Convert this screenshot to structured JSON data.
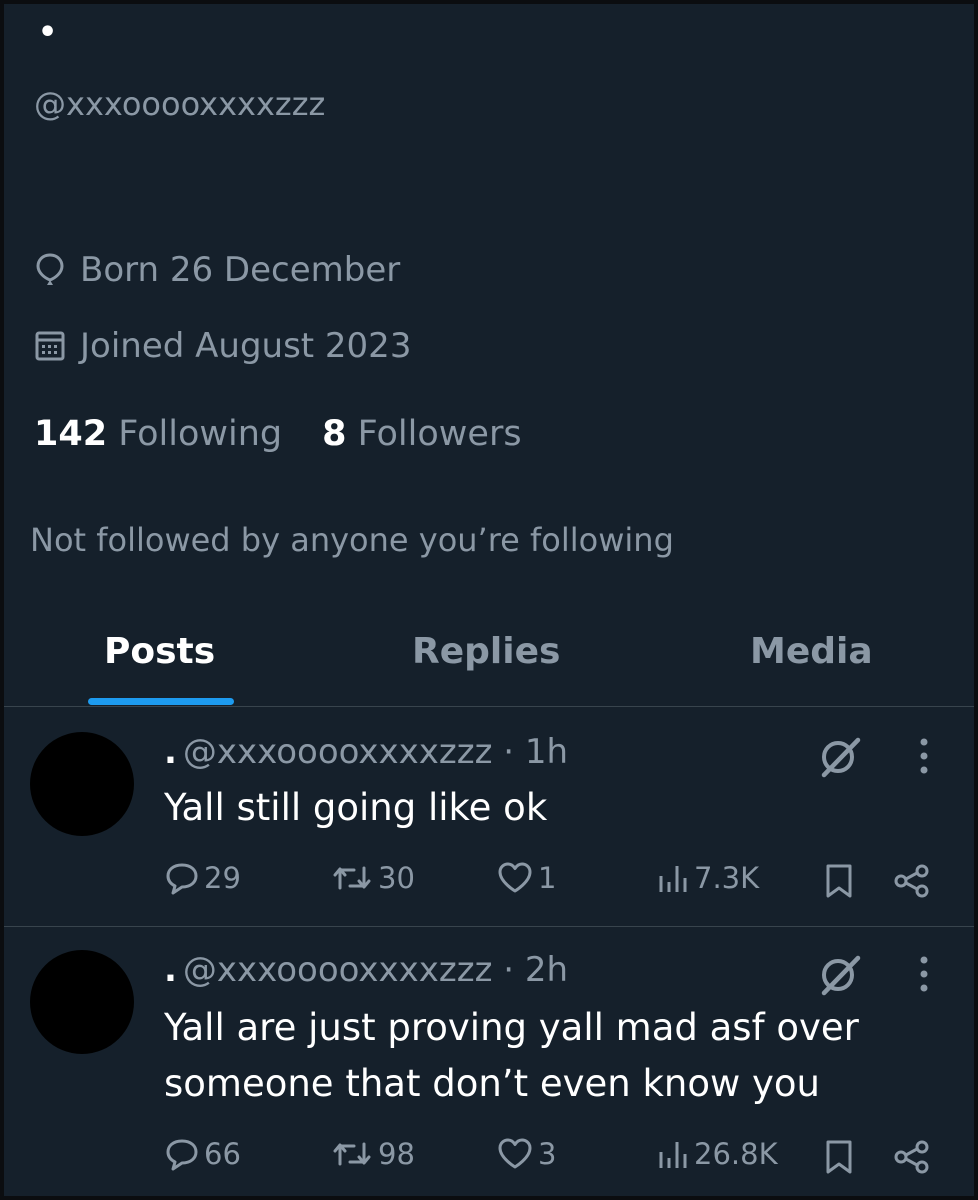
{
  "profile": {
    "display_name": "•",
    "handle": "@xxxooooxxxxzzz",
    "born": "Born 26 December",
    "joined": "Joined August 2023",
    "following_count": "142",
    "following_label": "Following",
    "followers_count": "8",
    "followers_label": "Followers",
    "not_followed": "Not followed by anyone you’re following"
  },
  "tabs": [
    {
      "label": "Posts",
      "active": true
    },
    {
      "label": "Replies",
      "active": false
    },
    {
      "label": "Media",
      "active": false
    }
  ],
  "posts": [
    {
      "name": ".",
      "handle": "@xxxooooxxxxzzz",
      "time": "· 1h",
      "text": "Yall still going like ok",
      "replies": "29",
      "reposts": "30",
      "likes": "1",
      "views": "7.3K"
    },
    {
      "name": ".",
      "handle": "@xxxooooxxxxzzz",
      "time": "· 2h",
      "text": "Yall are just proving yall mad asf over someone that don’t even know you",
      "replies": "66",
      "reposts": "98",
      "likes": "3",
      "views": "26.8K"
    }
  ],
  "icons": {
    "born": "balloon-icon",
    "joined": "calendar-icon",
    "grok": "grok-icon",
    "more": "more-vertical-icon",
    "reply": "reply-icon",
    "repost": "repost-icon",
    "like": "heart-icon",
    "views": "views-icon",
    "bookmark": "bookmark-icon",
    "share": "share-icon"
  },
  "colors": {
    "background": "#15202b",
    "accent": "#1d9bf0",
    "secondary_text": "#8b98a5",
    "divider": "#38444d"
  }
}
